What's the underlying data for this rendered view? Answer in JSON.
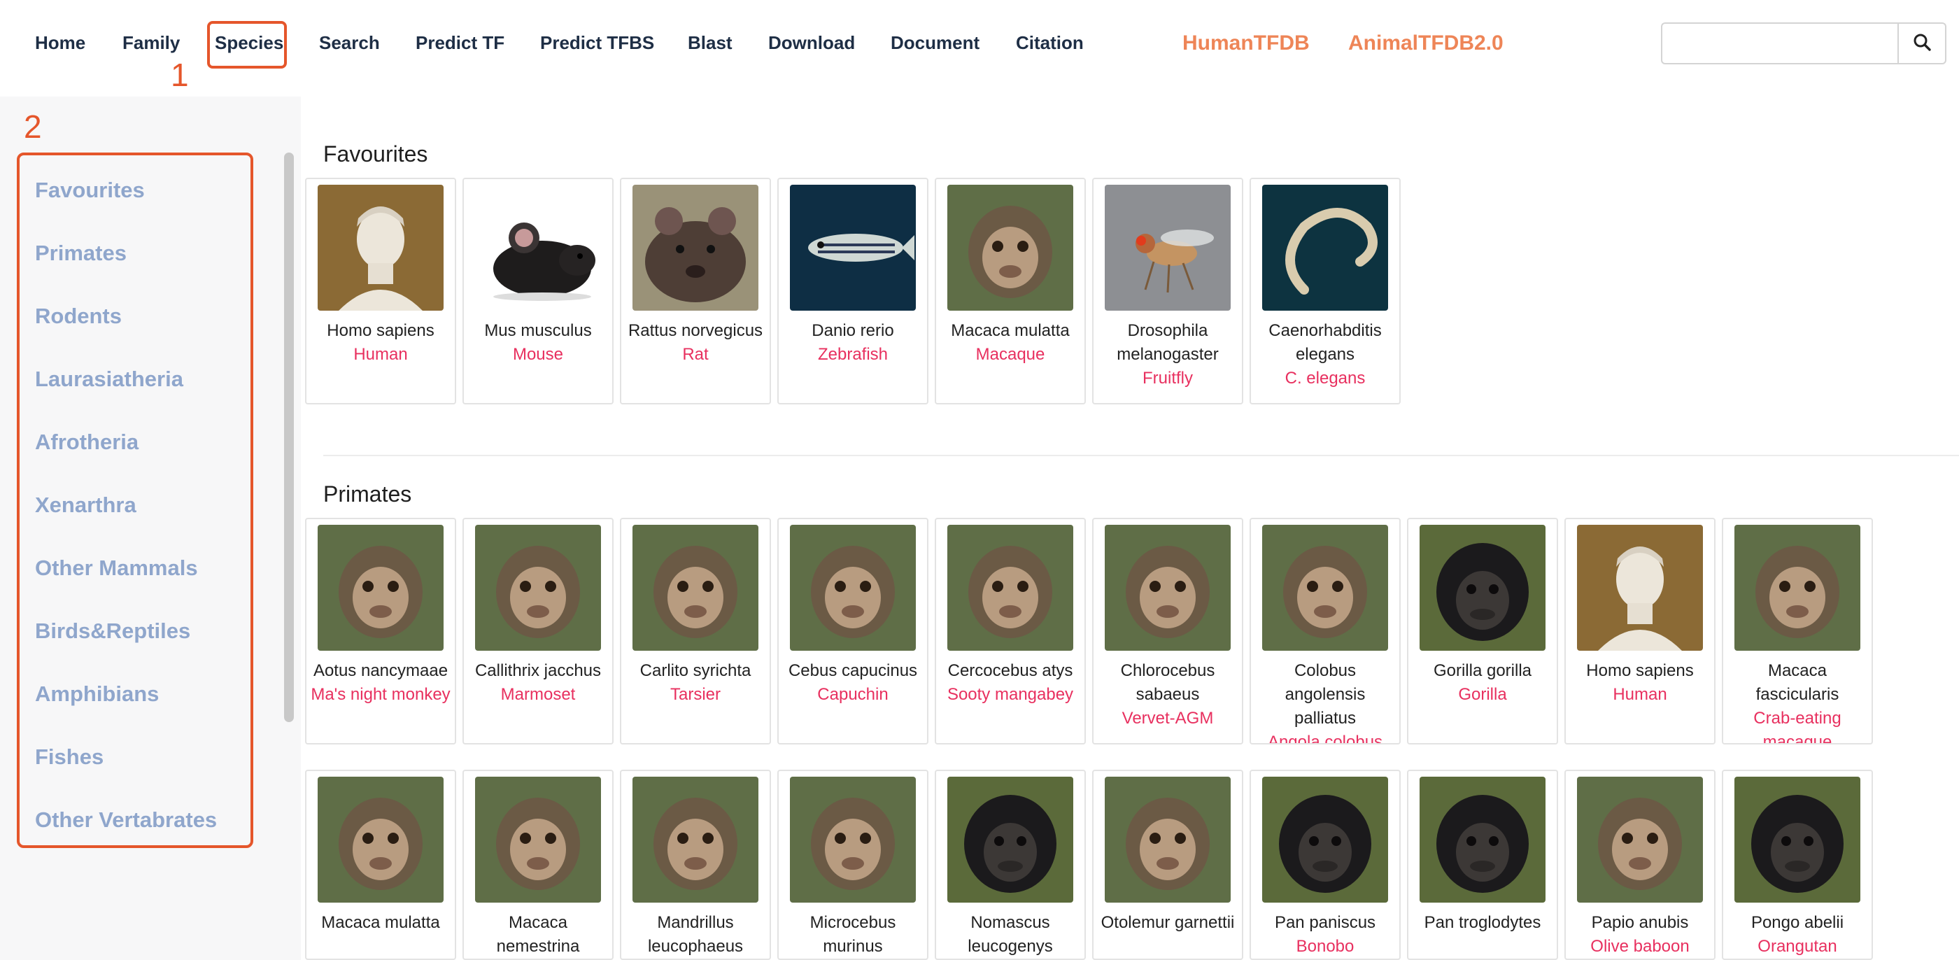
{
  "nav": {
    "items": [
      "Home",
      "Family",
      "Species",
      "Search",
      "Predict TF",
      "Predict TFBS",
      "Blast",
      "Download",
      "Document",
      "Citation"
    ],
    "brands": [
      "HumanTFDB",
      "AnimalTFDB2.0"
    ],
    "active": "Species"
  },
  "annotations": {
    "one": "1",
    "two": "2"
  },
  "search": {
    "placeholder": "",
    "icon": "search-icon"
  },
  "sidebar": {
    "items": [
      "Favourites",
      "Primates",
      "Rodents",
      "Laurasiatheria",
      "Afrotheria",
      "Xenarthra",
      "Other Mammals",
      "Birds&Reptiles",
      "Amphibians",
      "Fishes",
      "Other Vertabrates"
    ]
  },
  "sections": {
    "favourites": {
      "title": "Favourites",
      "cards": [
        {
          "sci": "Homo sapiens",
          "common": "Human",
          "photo": "statue"
        },
        {
          "sci": "Mus musculus",
          "common": "Mouse",
          "photo": "mouse"
        },
        {
          "sci": "Rattus norvegicus",
          "common": "Rat",
          "photo": "rat"
        },
        {
          "sci": "Danio rerio",
          "common": "Zebrafish",
          "photo": "fish"
        },
        {
          "sci": "Macaca mulatta",
          "common": "Macaque",
          "photo": "monkey"
        },
        {
          "sci": "Drosophila melanogaster",
          "common": "Fruitfly",
          "photo": "fly"
        },
        {
          "sci": "Caenorhabditis elegans",
          "common": "C. elegans",
          "photo": "worm"
        }
      ]
    },
    "primates": {
      "title": "Primates",
      "row1": [
        {
          "sci": "Aotus nancymaae",
          "common": "Ma's night monkey",
          "photo": "monkey"
        },
        {
          "sci": "Callithrix jacchus",
          "common": "Marmoset",
          "photo": "monkey"
        },
        {
          "sci": "Carlito syrichta",
          "common": "Tarsier",
          "photo": "monkey"
        },
        {
          "sci": "Cebus capucinus",
          "common": "Capuchin",
          "photo": "monkey"
        },
        {
          "sci": "Cercocebus atys",
          "common": "Sooty mangabey",
          "photo": "monkey"
        },
        {
          "sci": "Chlorocebus sabaeus",
          "common": "Vervet-AGM",
          "photo": "monkey"
        },
        {
          "sci": "Colobus angolensis palliatus",
          "common": "Angola colobus",
          "photo": "monkey"
        },
        {
          "sci": "Gorilla gorilla",
          "common": "Gorilla",
          "photo": "ape"
        },
        {
          "sci": "Homo sapiens",
          "common": "Human",
          "photo": "statue"
        },
        {
          "sci": "Macaca fascicularis",
          "common": "Crab-eating macaque",
          "photo": "monkey"
        }
      ],
      "row2": [
        {
          "sci": "Macaca mulatta",
          "common": "",
          "photo": "monkey"
        },
        {
          "sci": "Macaca nemestrina",
          "common": "",
          "photo": "monkey"
        },
        {
          "sci": "Mandrillus leucophaeus",
          "common": "",
          "photo": "monkey"
        },
        {
          "sci": "Microcebus murinus",
          "common": "",
          "photo": "monkey"
        },
        {
          "sci": "Nomascus leucogenys",
          "common": "",
          "photo": "ape"
        },
        {
          "sci": "Otolemur garnettii",
          "common": "",
          "photo": "monkey"
        },
        {
          "sci": "Pan paniscus",
          "common": "Bonobo",
          "photo": "ape"
        },
        {
          "sci": "Pan troglodytes",
          "common": "",
          "photo": "ape"
        },
        {
          "sci": "Papio anubis",
          "common": "Olive baboon",
          "photo": "monkey"
        },
        {
          "sci": "Pongo abelii",
          "common": "Orangutan",
          "photo": "ape"
        }
      ]
    }
  },
  "colors": {
    "nav_text": "#1e2e45",
    "brand": "#ee8557",
    "annotation": "#e5562b",
    "sidebar_text": "#8fa6cc",
    "common_name": "#e8305f"
  }
}
